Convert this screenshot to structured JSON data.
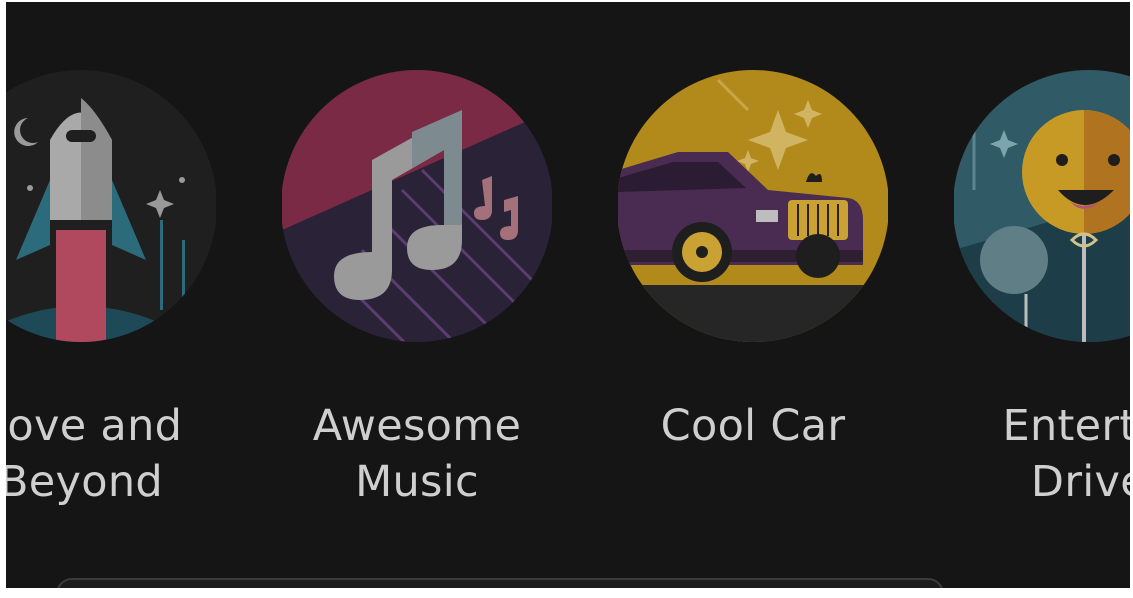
{
  "badges": [
    {
      "id": "above-beyond",
      "label_line1": "bove and",
      "label_line2": "Beyond",
      "icon": "rocket-icon"
    },
    {
      "id": "awesome-music",
      "label_line1": "Awesome",
      "label_line2": "Music",
      "icon": "music-note-icon"
    },
    {
      "id": "cool-car",
      "label_line1": "Cool Car",
      "label_line2": "",
      "icon": "car-icon"
    },
    {
      "id": "entertaining-driver",
      "label_line1": "Entertai",
      "label_line2": "Drive",
      "icon": "smiley-balloon-icon"
    }
  ],
  "colors": {
    "background": "#151515",
    "label": "#cfcfcf",
    "rocket_bg": "#202020",
    "music_pink": "#7a2a44",
    "music_dark": "#2a2236",
    "car_gold": "#b28a1c",
    "car_purple": "#4a2c52",
    "driver_teal": "#2f5a66"
  }
}
